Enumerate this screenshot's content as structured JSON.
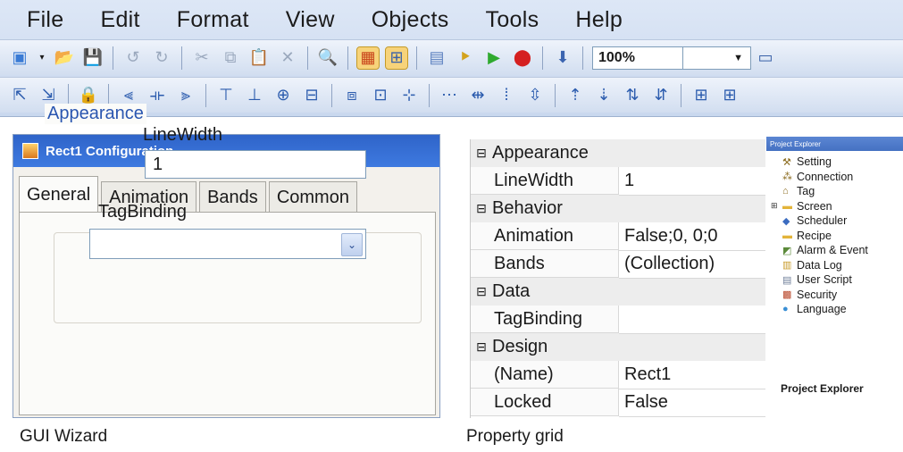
{
  "menu": [
    "File",
    "Edit",
    "Format",
    "View",
    "Objects",
    "Tools",
    "Help"
  ],
  "toolbar1": {
    "icons": [
      "new-icon",
      "open-folder-icon",
      "save-icon",
      "undo-icon",
      "redo-icon",
      "cut-icon",
      "copy-icon",
      "paste-icon",
      "delete-icon",
      "find-icon",
      "grid-icon",
      "snap-icon",
      "screen-icon",
      "build-icon",
      "run-icon",
      "stop-icon",
      "download-icon"
    ],
    "zoom_value": "100%"
  },
  "toolbar2": {
    "icons": [
      "bring-front-icon",
      "send-back-icon",
      "lock-icon",
      "align-left-icon",
      "align-center-icon",
      "align-right-icon",
      "align-top-icon",
      "align-bottom-icon",
      "center-h-icon",
      "center-v-icon",
      "same-size-icon",
      "group-icon",
      "ungroup-icon",
      "space-h-icon",
      "space-h2-icon",
      "space-v-icon",
      "space-v2-icon",
      "order-up-icon",
      "order-down-icon",
      "order-icon",
      "order2-icon",
      "expand-icon",
      "expand2-icon"
    ]
  },
  "wizard": {
    "title": "Rect1 Configuration",
    "tabs": [
      "General",
      "Animation",
      "Bands",
      "Common"
    ],
    "group_label": "Appearance",
    "linewidth_label": "LineWidth",
    "linewidth_value": "1",
    "tagbinding_label": "TagBinding",
    "tagbinding_value": ""
  },
  "property_grid": {
    "rows": [
      {
        "type": "category",
        "name": "Appearance"
      },
      {
        "type": "prop",
        "name": "LineWidth",
        "value": "1"
      },
      {
        "type": "category",
        "name": "Behavior"
      },
      {
        "type": "prop",
        "name": "Animation",
        "value": "False;0, 0;0"
      },
      {
        "type": "prop",
        "name": "Bands",
        "value": "(Collection)"
      },
      {
        "type": "category",
        "name": "Data"
      },
      {
        "type": "prop",
        "name": "TagBinding",
        "value": ""
      },
      {
        "type": "category",
        "name": "Design"
      },
      {
        "type": "prop",
        "name": "(Name)",
        "value": "Rect1"
      },
      {
        "type": "prop",
        "name": "Locked",
        "value": "False"
      }
    ]
  },
  "project_explorer": {
    "header": "Project Explorer",
    "items": [
      {
        "label": "Setting",
        "icon": "wrench-icon"
      },
      {
        "label": "Connection",
        "icon": "connection-icon"
      },
      {
        "label": "Tag",
        "icon": "tag-icon"
      },
      {
        "label": "Screen",
        "icon": "folder-icon",
        "expandable": true
      },
      {
        "label": "Scheduler",
        "icon": "scheduler-icon"
      },
      {
        "label": "Recipe",
        "icon": "folder-icon"
      },
      {
        "label": "Alarm & Event",
        "icon": "alarm-icon"
      },
      {
        "label": "Data Log",
        "icon": "datalog-icon"
      },
      {
        "label": "User Script",
        "icon": "script-icon"
      },
      {
        "label": "Security",
        "icon": "security-icon"
      },
      {
        "label": "Language",
        "icon": "language-icon"
      }
    ],
    "caption": "Project Explorer"
  },
  "captions": {
    "gui_wizard": "GUI Wizard",
    "property_grid": "Property grid"
  }
}
